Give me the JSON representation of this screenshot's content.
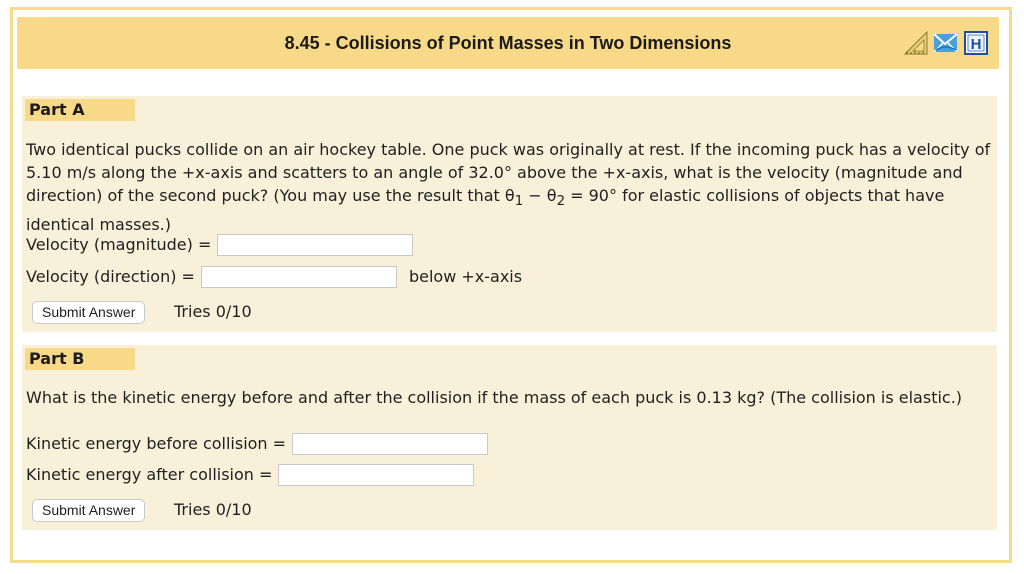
{
  "header": {
    "title": "8.45 - Collisions of Point Masses in Two Dimensions",
    "icons": [
      "triangle-ruler-icon",
      "envelope-icon",
      "handout-icon"
    ],
    "handout_letter": "H"
  },
  "colors": {
    "header_bg": "#f7d987",
    "panel_bg": "#f8f0d9",
    "frame_border": "#f3dc8c"
  },
  "parts": {
    "a": {
      "label": "Part A",
      "question_1": "Two identical pucks collide on an air hockey table. One puck was originally at rest. If the incoming puck has a velocity of 5.10 m/s along the +x-axis and scatters to an angle of 32.0° above the +x-axis, what is the velocity (magnitude and direction) of the second puck? (You may use the result that θ",
      "sub_1": "1",
      "minus": " − θ",
      "sub_2": "2",
      "question_2": " = 90° for elastic collisions of objects that have identical masses.)",
      "field_1_label": "Velocity (magnitude) =",
      "field_1_value": "",
      "field_2_label": "Velocity (direction) =",
      "field_2_value": "",
      "field_2_suffix": "below +x-axis",
      "submit_label": "Submit Answer",
      "tries": "Tries 0/10"
    },
    "b": {
      "label": "Part B",
      "question": "What is the kinetic energy before and after the collision if the mass of each puck is 0.13 kg? (The collision is elastic.)",
      "field_1_label": "Kinetic energy before collision =",
      "field_1_value": "",
      "field_2_label": "Kinetic energy after collision =",
      "field_2_value": "",
      "submit_label": "Submit Answer",
      "tries": "Tries 0/10"
    }
  }
}
